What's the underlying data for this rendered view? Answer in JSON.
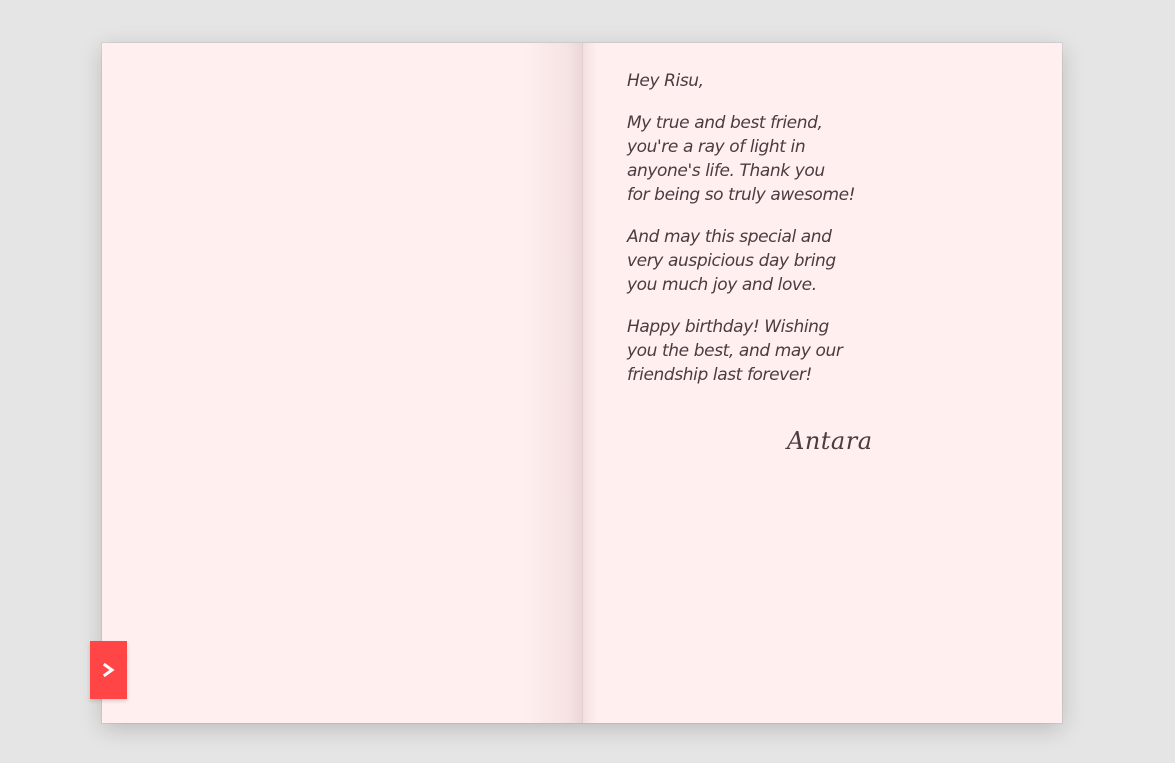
{
  "letter": {
    "greeting": "Hey Risu,",
    "paragraph_1": "My true and best friend,\nyou're a ray of light in\nanyone's life. Thank you\nfor being so truly awesome!",
    "paragraph_2": "And may this special and\nvery auspicious day bring\nyou much joy and love.",
    "paragraph_3": "Happy birthday! Wishing\nyou the best, and may our\nfriendship last forever!",
    "signature": "Antara"
  },
  "navigation": {
    "next_icon": "chevron-right-icon"
  },
  "colors": {
    "background": "#e5e5e5",
    "page": "#ffefef",
    "text": "#4a3c40",
    "button": "#ff4545"
  }
}
